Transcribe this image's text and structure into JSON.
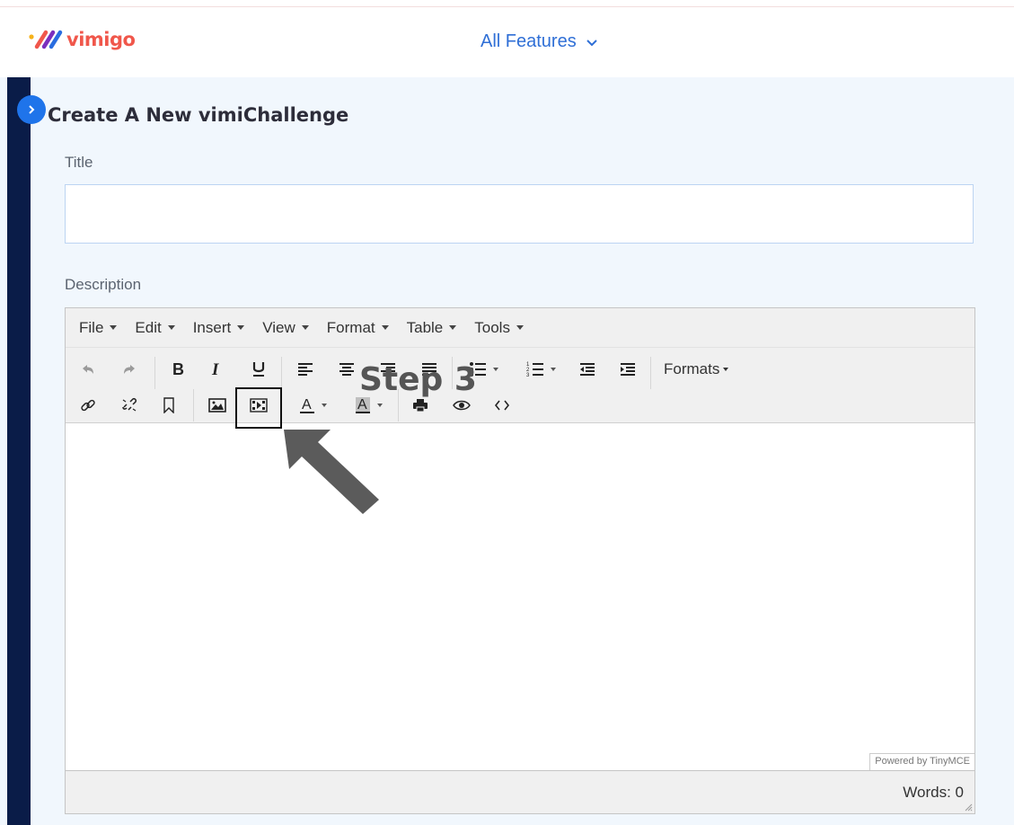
{
  "brand": {
    "name": "vimigo",
    "accent": "#f0574b",
    "logo_stripe_colors": [
      "#f6b21a",
      "#f0574b",
      "#7b2fbe",
      "#2a6de0"
    ]
  },
  "nav": {
    "menu_label": "All Features"
  },
  "page": {
    "title": "Create A New vimiChallenge",
    "title_label": "Title",
    "title_value": "",
    "description_label": "Description"
  },
  "editor": {
    "menus": [
      "File",
      "Edit",
      "Insert",
      "View",
      "Format",
      "Table",
      "Tools"
    ],
    "toolbar_row1": [
      "undo",
      "redo",
      "bold",
      "italic",
      "underline",
      "align-left",
      "align-center",
      "align-right",
      "align-justify",
      "bullet-list",
      "numbered-list",
      "outdent",
      "indent"
    ],
    "formats_label": "Formats",
    "toolbar_row2": [
      "link",
      "unlink",
      "bookmark",
      "image",
      "media",
      "text-color",
      "background-color",
      "print",
      "preview",
      "source-code"
    ],
    "powered_by": "Powered by TinyMCE",
    "word_count_label": "Words: 0"
  },
  "annotation": {
    "step_label": "Step 3"
  }
}
